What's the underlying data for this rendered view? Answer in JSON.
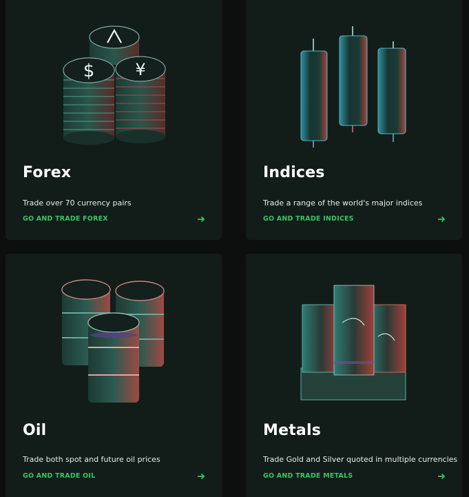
{
  "accent_color": "#39c463",
  "card_background": "#121d1a",
  "page_background": "#0d0f0e",
  "cards": [
    {
      "title": "Forex",
      "description": "Trade over 70 currency pairs",
      "cta": "GO AND TRADE FOREX",
      "icon": "coin-stack-icon",
      "arrow_icon": "arrow-right-icon"
    },
    {
      "title": "Indices",
      "description": "Trade a range of the world's major indices",
      "cta": "GO AND TRADE INDICES",
      "icon": "candlestick-icon",
      "arrow_icon": "arrow-right-icon"
    },
    {
      "title": "Oil",
      "description": "Trade both spot and future oil prices",
      "cta": "GO AND TRADE OIL",
      "icon": "oil-barrels-icon",
      "arrow_icon": "arrow-right-icon"
    },
    {
      "title": "Metals",
      "description": "Trade Gold and Silver quoted in multiple currencies",
      "cta": "GO AND TRADE METALS",
      "icon": "metal-bars-icon",
      "arrow_icon": "arrow-right-icon"
    }
  ]
}
